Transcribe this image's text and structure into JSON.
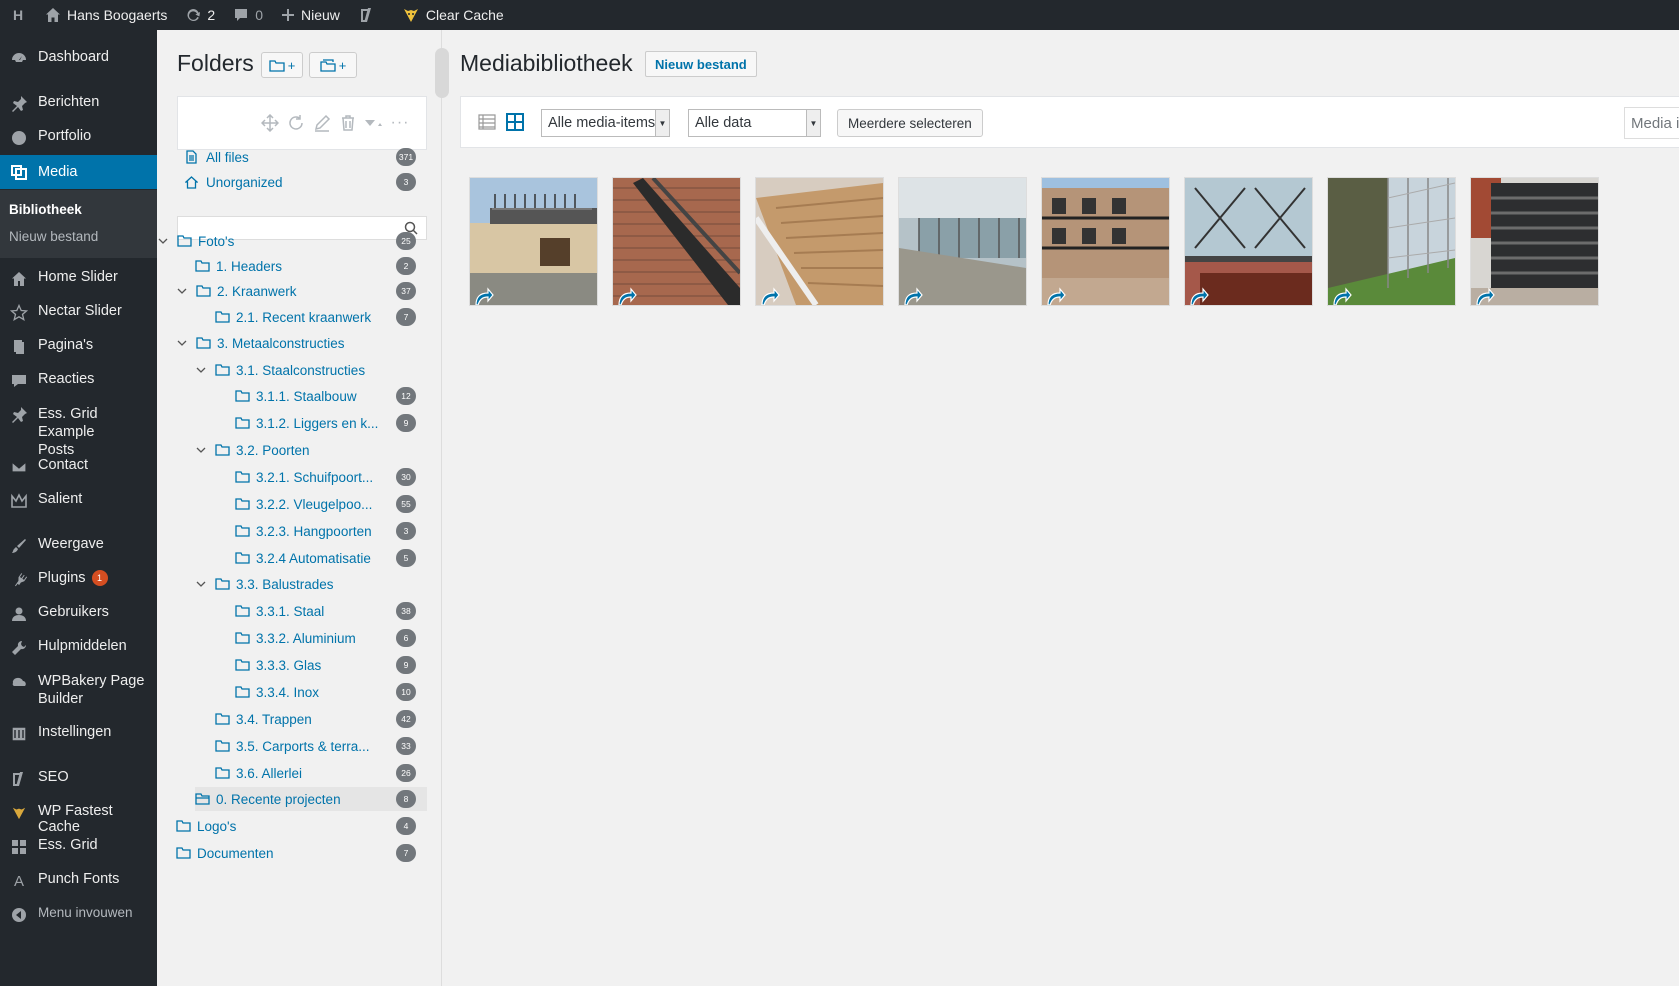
{
  "adminbar": {
    "site_name": "Hans Boogaerts",
    "updates_count": "2",
    "comments_count": "0",
    "new_label": "Nieuw",
    "clear_cache_label": "Clear Cache"
  },
  "menu": {
    "dashboard": "Dashboard",
    "berichten": "Berichten",
    "portfolio": "Portfolio",
    "media": "Media",
    "submenu_bibliotheek": "Bibliotheek",
    "submenu_nieuw": "Nieuw bestand",
    "home_slider": "Home Slider",
    "nectar_slider": "Nectar Slider",
    "paginas": "Pagina's",
    "reacties": "Reacties",
    "ess_grid_posts_line1": "Ess. Grid Example",
    "ess_grid_posts_line2": "Posts",
    "contact": "Contact",
    "salient": "Salient",
    "weergave": "Weergave",
    "plugins": "Plugins",
    "plugins_badge": "1",
    "gebruikers": "Gebruikers",
    "hulpmiddelen": "Hulpmiddelen",
    "wpbakery_line1": "WPBakery Page",
    "wpbakery_line2": "Builder",
    "instellingen": "Instellingen",
    "seo": "SEO",
    "wp_fastest_cache": "WP Fastest Cache",
    "ess_grid": "Ess. Grid",
    "punch_fonts": "Punch Fonts",
    "menu_invouwen": "Menu invouwen"
  },
  "folders": {
    "title": "Folders",
    "all_files": {
      "label": "All files",
      "count": "371"
    },
    "unorganized": {
      "label": "Unorganized",
      "count": "3"
    },
    "tree": [
      {
        "label": "Foto's",
        "count": "25"
      },
      {
        "label": "1. Headers",
        "count": "2"
      },
      {
        "label": "2. Kraanwerk",
        "count": "37"
      },
      {
        "label": "2.1. Recent kraanwerk",
        "count": "7"
      },
      {
        "label": "3. Metaalconstructies",
        "count": ""
      },
      {
        "label": "3.1. Staalconstructies",
        "count": ""
      },
      {
        "label": "3.1.1. Staalbouw",
        "count": "12"
      },
      {
        "label": "3.1.2. Liggers en k...",
        "count": "9"
      },
      {
        "label": "3.2. Poorten",
        "count": ""
      },
      {
        "label": "3.2.1. Schuifpoort...",
        "count": "30"
      },
      {
        "label": "3.2.2. Vleugelpoo...",
        "count": "55"
      },
      {
        "label": "3.2.3. Hangpoorten",
        "count": "3"
      },
      {
        "label": "3.2.4 Automatisatie",
        "count": "5"
      },
      {
        "label": "3.3. Balustrades",
        "count": ""
      },
      {
        "label": "3.3.1. Staal",
        "count": "38"
      },
      {
        "label": "3.3.2. Aluminium",
        "count": "6"
      },
      {
        "label": "3.3.3. Glas",
        "count": "9"
      },
      {
        "label": "3.3.4. Inox",
        "count": "10"
      },
      {
        "label": "3.4. Trappen",
        "count": "42"
      },
      {
        "label": "3.5. Carports & terra...",
        "count": "33"
      },
      {
        "label": "3.6. Allerlei",
        "count": "26"
      },
      {
        "label": "0. Recente projecten",
        "count": "8"
      },
      {
        "label": "Logo's",
        "count": "4"
      },
      {
        "label": "Documenten",
        "count": "7"
      }
    ]
  },
  "main": {
    "title": "Mediabibliotheek",
    "new_file_button": "Nieuw bestand",
    "filter_type": "Alle media-items",
    "filter_date": "Alle data",
    "bulk_select": "Meerdere selecteren",
    "search_placeholder": "Media items zoeken"
  },
  "colors": {
    "admin_dark": "#23282d",
    "accent": "#0073aa",
    "submenu_bg": "#32373c",
    "badge_red": "#d54e21"
  }
}
